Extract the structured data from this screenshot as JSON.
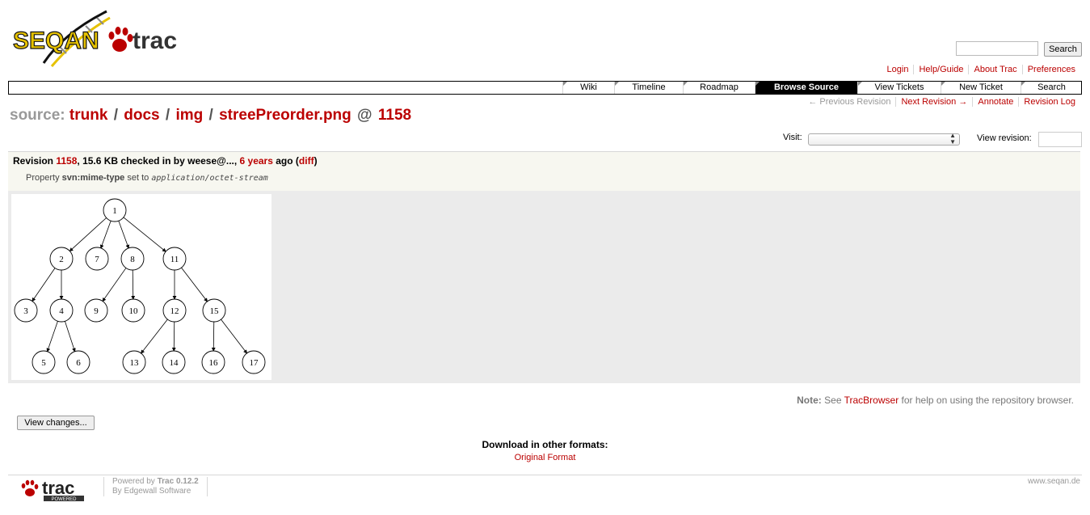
{
  "logo": {
    "project": "SEQAN",
    "product": "trac"
  },
  "search": {
    "value": "",
    "button_label": "Search"
  },
  "metanav": [
    "Login",
    "Help/Guide",
    "About Trac",
    "Preferences"
  ],
  "mainnav": [
    "Wiki",
    "Timeline",
    "Roadmap",
    "Browse Source",
    "View Tickets",
    "New Ticket",
    "Search"
  ],
  "mainnav_active": "Browse Source",
  "ctxnav": {
    "previous": "← Previous Revision",
    "next": "Next Revision →",
    "annotate": "Annotate",
    "log": "Revision Log"
  },
  "path": {
    "label": "source:",
    "segments": [
      "trunk",
      "docs",
      "img",
      "streePreorder.png"
    ],
    "separator": "/",
    "at": "@",
    "revision": "1158"
  },
  "visit": {
    "label": "Visit:",
    "selected": ""
  },
  "view_revision": {
    "label": "View revision:",
    "value": ""
  },
  "info": {
    "revision_label": "Revision",
    "revision": "1158",
    "size_text": ", 15.6 KB checked in by weese@..., ",
    "age": "6 years",
    "ago": " ago (",
    "diff": "diff",
    "close": ")",
    "property_prefix": "Property ",
    "property_name": "svn:mime-type",
    "property_mid": " set to ",
    "property_value": "application/octet-stream"
  },
  "tree": {
    "nodes": [
      "1",
      "2",
      "7",
      "8",
      "11",
      "3",
      "4",
      "9",
      "10",
      "12",
      "15",
      "5",
      "6",
      "13",
      "14",
      "16",
      "17"
    ]
  },
  "note": {
    "label": "Note:",
    "pre": " See ",
    "link": "TracBrowser",
    "post": " for help on using the repository browser."
  },
  "view_changes": "View changes...",
  "alt_formats": {
    "title": "Download in other formats:",
    "link": "Original Format"
  },
  "footer": {
    "trac_logo_text": "trac",
    "trac_logo_badge": "POWERED",
    "powered_by": "Powered by ",
    "trac_version": "Trac 0.12.2",
    "by": "By ",
    "edgewall": "Edgewall Software",
    "site": "www.seqan.de"
  }
}
